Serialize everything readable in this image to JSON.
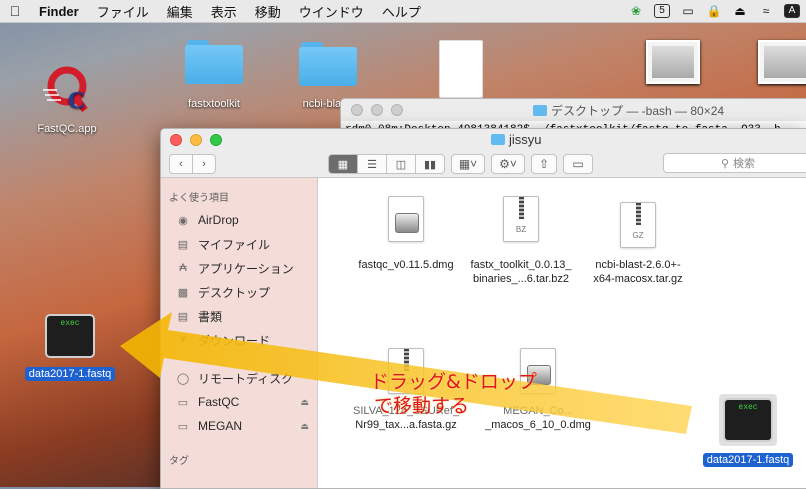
{
  "menubar": {
    "app": "Finder",
    "items": [
      "ファイル",
      "編集",
      "表示",
      "移動",
      "ウインドウ",
      "ヘルプ"
    ],
    "status_icons": [
      "leaf-icon",
      "badge-5-icon",
      "airplay-icon",
      "lock-icon",
      "eject-icon",
      "wifi-icon"
    ],
    "input_indicator": "A"
  },
  "desktop": {
    "icons": [
      {
        "label": "FastQC.app",
        "icon": "fastqc-logo-icon"
      },
      {
        "label": "fastxtoolkit",
        "icon": "folder-icon"
      },
      {
        "label": "ncbi-blast-",
        "icon": "folder-icon"
      }
    ],
    "dragged_file": {
      "label": "data2017-1.fastq",
      "icon_text": "exec"
    }
  },
  "terminal": {
    "title": "デスクトップ — -bash — 80×24",
    "line": "rdm0-08m:Desktop 4981384182$ ./fastxtoolkit/fastq_to_fasta -Q33 -h"
  },
  "finder": {
    "title": "jissyu",
    "search_placeholder": "検索",
    "sidebar": {
      "favorites_header": "よく使う項目",
      "items": [
        {
          "label": "AirDrop",
          "icon": "airdrop-icon"
        },
        {
          "label": "マイファイル",
          "icon": "my-files-icon"
        },
        {
          "label": "アプリケーション",
          "icon": "applications-icon"
        },
        {
          "label": "デスクトップ",
          "icon": "desktop-icon"
        },
        {
          "label": "書類",
          "icon": "documents-icon"
        },
        {
          "label": "ダウンロード",
          "icon": "downloads-icon"
        }
      ],
      "devices": [
        {
          "label": "リモートディスク",
          "icon": "remote-disc-icon",
          "eject": false
        },
        {
          "label": "FastQC",
          "icon": "drive-icon",
          "eject": true
        },
        {
          "label": "MEGAN",
          "icon": "drive-icon",
          "eject": true
        }
      ],
      "tags_header": "タグ"
    },
    "files": [
      {
        "line1": "fastqc_v0.11.5.dmg",
        "line2": "",
        "type": "dmg",
        "ext": ""
      },
      {
        "line1": "fastx_toolkit_0.0.13_",
        "line2": "binaries_...6.tar.bz2",
        "type": "zip",
        "ext": "BZ"
      },
      {
        "line1": "ncbi-blast-2.6.0+-",
        "line2": "x64-macosx.tar.gz",
        "type": "zip",
        "ext": "GZ"
      },
      {
        "line1": "SILVA_128_SSURef_",
        "line2": "Nr99_tax...a.fasta.gz",
        "type": "zip",
        "ext": "GZ"
      },
      {
        "line1": "MEGAN_Co...",
        "line2": "_macos_6_10_0.dmg",
        "type": "dmg",
        "ext": ""
      }
    ],
    "dragged_file": {
      "label": "data2017-1.fastq",
      "icon_text": "exec"
    }
  },
  "annotation": {
    "line1": "ドラッグ&ドロップ",
    "line2": "で移動する",
    "arrow_color": "#f5b800",
    "text_color": "#e0141e"
  }
}
